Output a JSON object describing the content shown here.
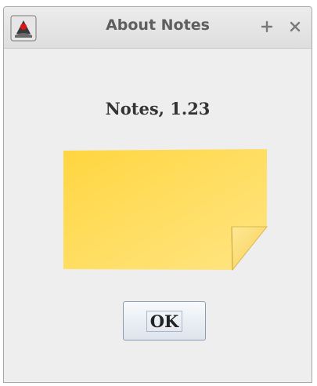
{
  "window": {
    "title": "About Notes",
    "maximize_icon": "plus-icon",
    "close_icon": "close-icon",
    "app_icon": "java-duke-icon"
  },
  "content": {
    "heading": "Notes,  1.23",
    "illustration": "sticky-note",
    "ok_label": "OK"
  },
  "colors": {
    "note_yellow_light": "#ffe37a",
    "note_yellow_dark": "#ffd64a",
    "button_border": "#8c9cb0",
    "title_text": "#5f5f5f"
  }
}
